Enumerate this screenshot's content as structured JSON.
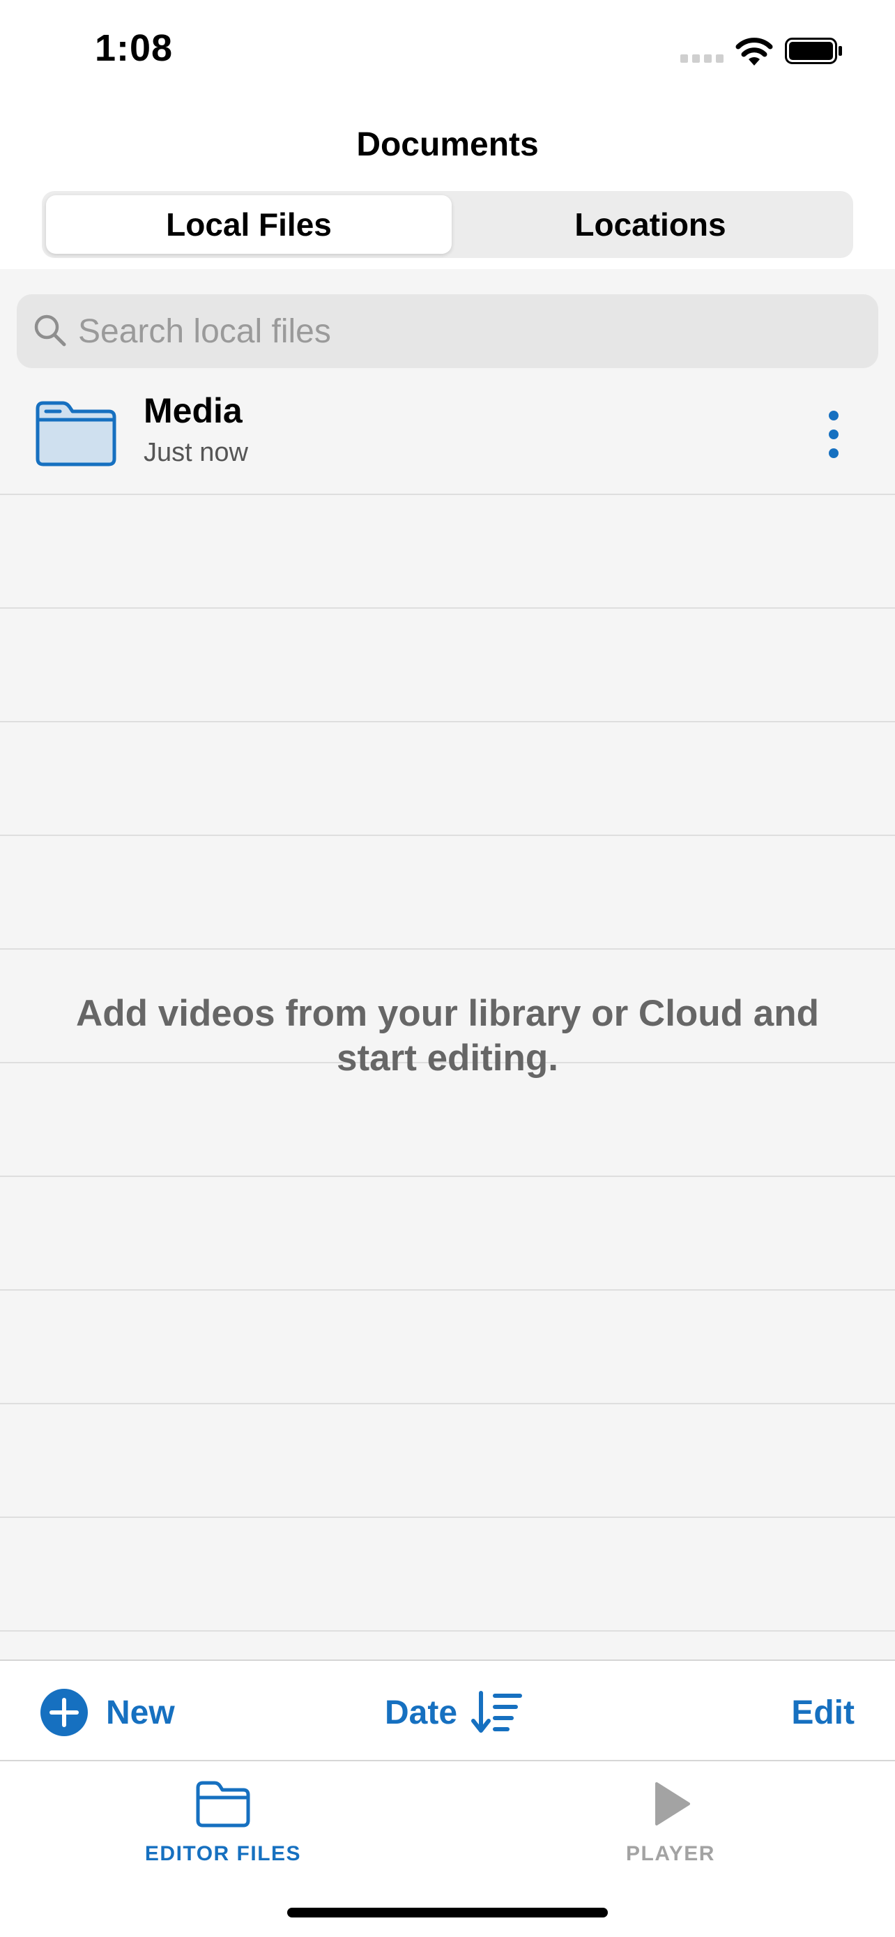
{
  "status_bar": {
    "time": "1:08"
  },
  "header": {
    "title": "Documents",
    "segments": [
      {
        "label": "Local Files",
        "selected": true
      },
      {
        "label": "Locations",
        "selected": false
      }
    ]
  },
  "search": {
    "placeholder": "Search local files",
    "value": ""
  },
  "files": [
    {
      "name": "Media",
      "modified": "Just now",
      "icon": "folder-icon"
    }
  ],
  "empty_message": "Add videos from your library or Cloud and start editing.",
  "toolbar": {
    "new_label": "New",
    "sort_label": "Date",
    "edit_label": "Edit"
  },
  "tabs": [
    {
      "label": "EDITOR FILES",
      "icon": "folder-icon",
      "active": true
    },
    {
      "label": "PLAYER",
      "icon": "play-icon",
      "active": false
    }
  ],
  "colors": {
    "accent": "#1670c0",
    "inactive_tab": "#a3a3a3",
    "content_background": "#f5f5f5"
  }
}
